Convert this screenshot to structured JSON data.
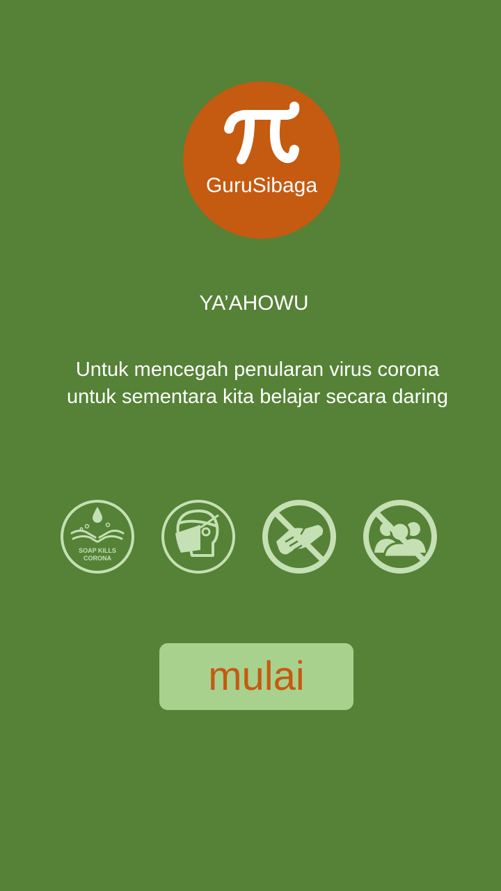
{
  "colors": {
    "background": "#558236",
    "logo_circle": "#c55a11",
    "icon_stroke": "#c5e0b4",
    "button_fill": "#a9d18e",
    "button_text": "#c55a11",
    "text": "#ffffff"
  },
  "logo": {
    "icon": "pi-icon",
    "brand_name": "GuruSibaga"
  },
  "greeting": "YA’AHOWU",
  "message": "Untuk mencegah penularan virus corona untuk sementara kita belajar secara daring",
  "prevention_icons": [
    {
      "icon": "hand-washing-icon",
      "label": "SOAP KILLS CORONA"
    },
    {
      "icon": "face-mask-icon"
    },
    {
      "icon": "no-handshake-icon"
    },
    {
      "icon": "no-crowd-icon"
    }
  ],
  "start_button": {
    "label": "mulai"
  }
}
